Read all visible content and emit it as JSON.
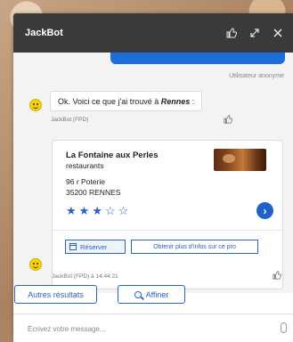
{
  "header": {
    "title": "JackBot",
    "icons": [
      "thumb-up-icon",
      "expand-icon",
      "close-icon"
    ]
  },
  "user_message": {
    "meta": "Utilisateur anonyme"
  },
  "bot_message": {
    "text_prefix": "Ok. Voici ce que j'ai trouvé à ",
    "text_place": "Rennes",
    "text_suffix": " :",
    "meta": "JackBot (FPD)"
  },
  "card": {
    "name": "La Fontaine aux Perles",
    "category": "restaurants",
    "address_line1": "96 r Poterie",
    "address_line2": "35200 RENNES",
    "rating": 3,
    "rating_max": 5,
    "star_filled": "★",
    "star_empty": "☆",
    "next_glyph": "›",
    "reserve_label": "Réserver",
    "info_label": "Obtenir plus d'infos sur ce pro",
    "meta": "JackBot (FPD) à 14:44:21"
  },
  "actions": {
    "more_results": "Autres résultats",
    "refine": "Affiner"
  },
  "composer": {
    "placeholder": "Écrivez votre message..."
  },
  "colors": {
    "accent": "#2a64c8",
    "header_bg": "#3a3a3a",
    "user_bubble": "#1b6fd6"
  }
}
